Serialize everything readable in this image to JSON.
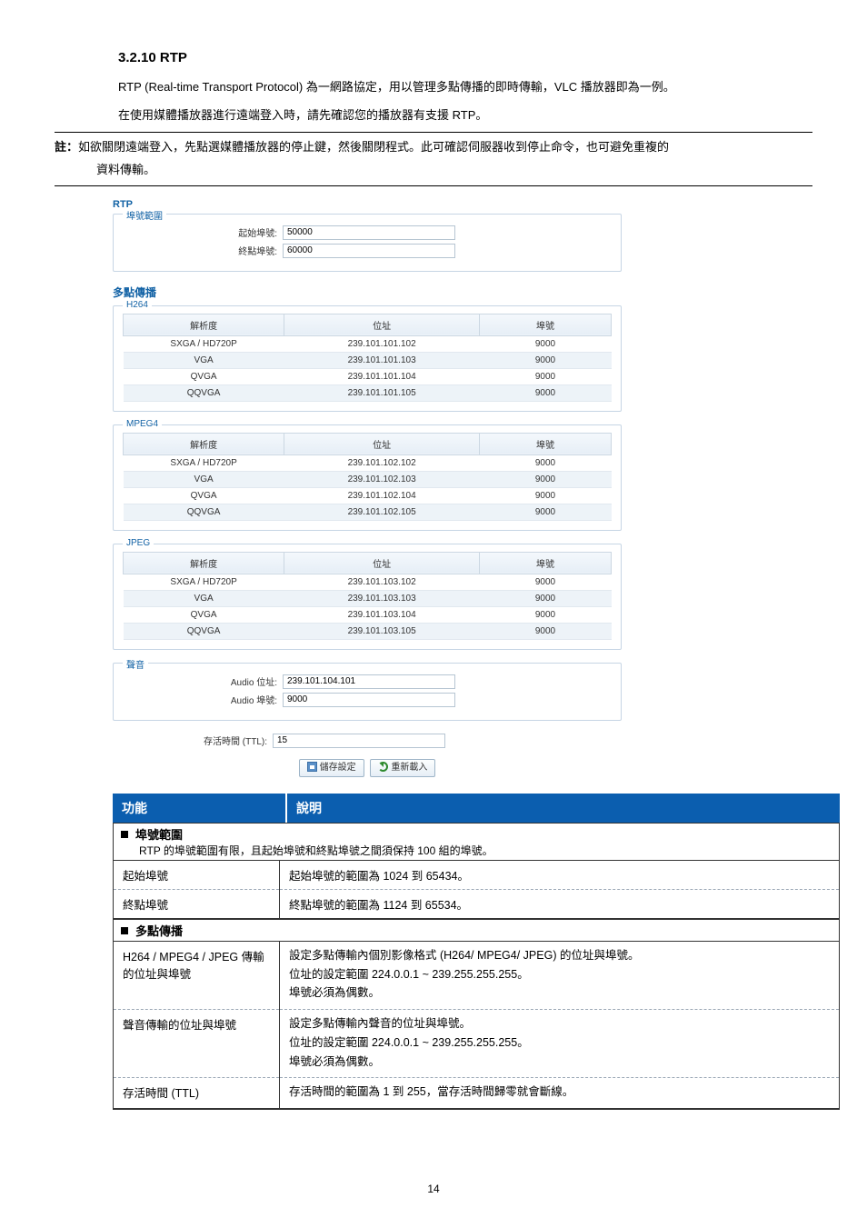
{
  "heading": "3.2.10 RTP",
  "intro1": "RTP (Real-time Transport Protocol)  為一網路協定，用以管理多點傳播的即時傳輸，VLC 播放器即為一例。",
  "intro2": "在使用媒體播放器進行遠端登入時，請先確認您的播放器有支援 RTP。",
  "note_label": "註：",
  "note_line1": "如欲關閉遠端登入，先點選媒體播放器的停止鍵，然後關閉程式。此可確認伺服器收到停止命令，也可避免重複的",
  "note_line2": "資料傳輸。",
  "panel": {
    "rtp_title": "RTP",
    "port_group_legend": "埠號範圍",
    "start_port_label": "起始埠號:",
    "start_port_value": "50000",
    "end_port_label": "終點埠號:",
    "end_port_value": "60000",
    "multicast_title": "多點傳播",
    "codec_headers": {
      "res": "解析度",
      "addr": "位址",
      "port": "埠號"
    },
    "h264": {
      "legend": "H264",
      "rows": [
        {
          "res": "SXGA / HD720P",
          "addr": "239.101.101.102",
          "port": "9000"
        },
        {
          "res": "VGA",
          "addr": "239.101.101.103",
          "port": "9000"
        },
        {
          "res": "QVGA",
          "addr": "239.101.101.104",
          "port": "9000"
        },
        {
          "res": "QQVGA",
          "addr": "239.101.101.105",
          "port": "9000"
        }
      ]
    },
    "mpeg4": {
      "legend": "MPEG4",
      "rows": [
        {
          "res": "SXGA / HD720P",
          "addr": "239.101.102.102",
          "port": "9000"
        },
        {
          "res": "VGA",
          "addr": "239.101.102.103",
          "port": "9000"
        },
        {
          "res": "QVGA",
          "addr": "239.101.102.104",
          "port": "9000"
        },
        {
          "res": "QQVGA",
          "addr": "239.101.102.105",
          "port": "9000"
        }
      ]
    },
    "jpeg": {
      "legend": "JPEG",
      "rows": [
        {
          "res": "SXGA / HD720P",
          "addr": "239.101.103.102",
          "port": "9000"
        },
        {
          "res": "VGA",
          "addr": "239.101.103.103",
          "port": "9000"
        },
        {
          "res": "QVGA",
          "addr": "239.101.103.104",
          "port": "9000"
        },
        {
          "res": "QQVGA",
          "addr": "239.101.103.105",
          "port": "9000"
        }
      ]
    },
    "audio": {
      "legend": "聲音",
      "addr_label": "Audio 位址:",
      "addr_value": "239.101.104.101",
      "port_label": "Audio 埠號:",
      "port_value": "9000"
    },
    "ttl_label": "存活時間 (TTL):",
    "ttl_value": "15",
    "btn_save": "儲存設定",
    "btn_reload": "重新載入"
  },
  "desc": {
    "col_func": "功能",
    "col_desc": "說明",
    "sec1_title": "埠號範圍",
    "sec1_sub": "RTP 的埠號範圍有限，且起始埠號和終點埠號之間須保持 100 組的埠號。",
    "rows1": [
      {
        "k": "起始埠號",
        "v": "起始埠號的範圍為 1024 到 65434。"
      },
      {
        "k": "終點埠號",
        "v": "終點埠號的範圍為 1124 到 65534。"
      }
    ],
    "sec2_title": "多點傳播",
    "rows2": [
      {
        "k": "H264 / MPEG4 / JPEG 傳輸的位址與埠號",
        "v": [
          "設定多點傳輸內個別影像格式  (H264/ MPEG4/ JPEG)  的位址與埠號。",
          "位址的設定範圍 224.0.0.1 ~ 239.255.255.255。",
          "埠號必須為偶數。"
        ]
      },
      {
        "k": "聲音傳輸的位址與埠號",
        "v": [
          "設定多點傳輸內聲音的位址與埠號。",
          "位址的設定範圍 224.0.0.1 ~ 239.255.255.255。",
          "埠號必須為偶數。"
        ]
      },
      {
        "k": "存活時間  (TTL)",
        "v": [
          "存活時間的範圍為 1 到 255，當存活時間歸零就會斷線。"
        ]
      }
    ]
  },
  "page_number": "14"
}
